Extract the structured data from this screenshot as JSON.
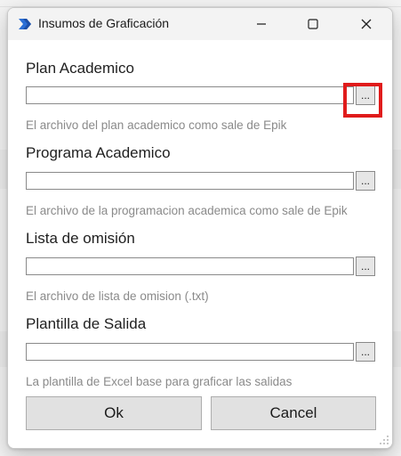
{
  "window": {
    "title": "Insumos de Graficación",
    "controls": {
      "minimize": "minimize",
      "maximize": "maximize",
      "close": "close"
    }
  },
  "fields": [
    {
      "label": "Plan Academico",
      "value": "",
      "browse_label": "...",
      "hint": "El archivo del plan academico como sale de Epik"
    },
    {
      "label": "Programa Academico",
      "value": "",
      "browse_label": "...",
      "hint": "El archivo de la programacion academica como sale de Epik"
    },
    {
      "label": "Lista de omisión",
      "value": "",
      "browse_label": "...",
      "hint": "El archivo de lista de omision (.txt)"
    },
    {
      "label": "Plantilla de Salida",
      "value": "",
      "browse_label": "...",
      "hint": "La plantilla de Excel base para graficar las salidas"
    }
  ],
  "buttons": {
    "ok": "Ok",
    "cancel": "Cancel"
  },
  "colors": {
    "highlight": "#e01b1b",
    "app_icon": "#2b6fd6"
  }
}
